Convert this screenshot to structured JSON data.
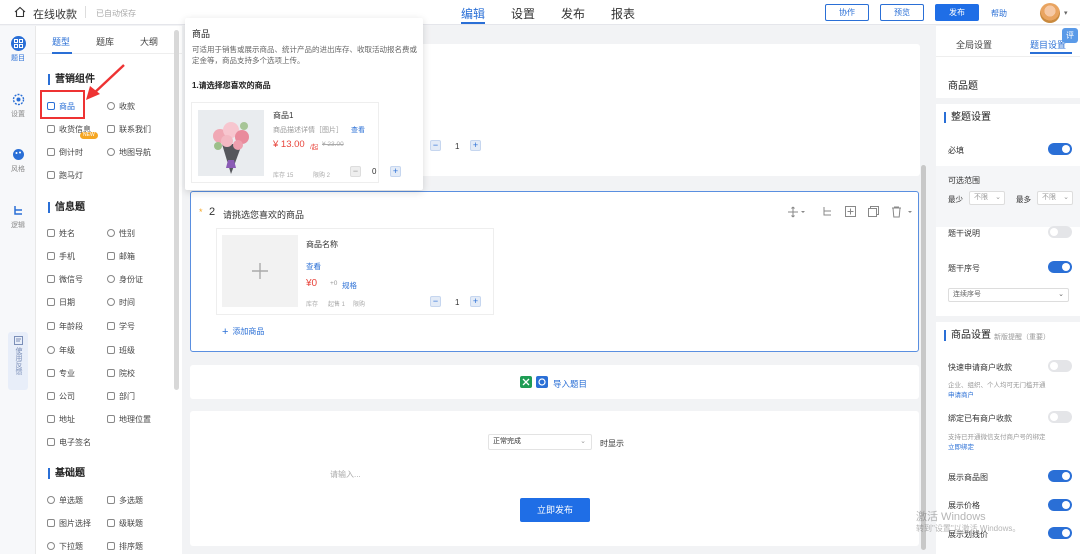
{
  "topbar": {
    "app_title": "在线收款",
    "autosave": "已自动保存",
    "nav": [
      "编辑",
      "设置",
      "发布",
      "报表"
    ],
    "collab": "协作",
    "preview": "预览",
    "publish": "发布",
    "help": "帮助"
  },
  "rail": {
    "items": [
      "题目",
      "设置",
      "风格",
      "逻辑"
    ],
    "feedback": "使用反馈"
  },
  "palette": {
    "tabs": [
      "题型",
      "题库",
      "大纲"
    ],
    "marketing_title": "营销组件",
    "marketing": [
      "商品",
      "收款",
      "收货信息",
      "联系我们",
      "倒计时",
      "地图导航",
      "跑马灯"
    ],
    "new_badge": "NEW",
    "info_title": "信息题",
    "info": [
      "姓名",
      "性别",
      "手机",
      "邮箱",
      "微信号",
      "身份证",
      "日期",
      "时间",
      "年龄段",
      "学号",
      "年级",
      "班级",
      "专业",
      "院校",
      "公司",
      "部门",
      "地址",
      "地理位置",
      "电子签名"
    ],
    "basic_title": "基础题",
    "basic": [
      "单选题",
      "多选题",
      "图片选择",
      "级联题",
      "下拉题",
      "排序题"
    ]
  },
  "popup": {
    "title": "商品",
    "description": "可适用于销售或展示商品、统计产品的进出库存、收取活动报名费或定金等，商品支持多个选项上传。",
    "question": "1.请选择您喜欢的商品",
    "product": {
      "name": "商品1",
      "desc": "商品描述详情［图片］",
      "view": "查看",
      "price": "¥ 13.00",
      "price_unit": "/起",
      "original": "¥ 23.00",
      "stock": "库存 15",
      "limit": "限购 2",
      "qty": "0"
    }
  },
  "q1": {
    "qty": "1"
  },
  "q2": {
    "number": "2",
    "title": "请挑选您喜欢的商品",
    "product_name": "商品名称",
    "view": "查看",
    "price": "¥0",
    "spec_prefix": "+0",
    "spec": "规格",
    "meta": [
      "库存",
      "起售 1",
      "限购"
    ],
    "qty": "1",
    "add": "添加商品"
  },
  "import": {
    "label": "导入题目"
  },
  "footer": {
    "status_select": "正常完成",
    "show_label": "时显示",
    "input_placeholder": "请输入...",
    "publish": "立即发布"
  },
  "right": {
    "tabs": [
      "全局设置",
      "题目设置"
    ],
    "question_type": "商品题",
    "overall_title": "整题设置",
    "required": "必填",
    "range": "可选范围",
    "min": "最少",
    "min_val": "不限",
    "max": "最多",
    "max_val": "不限",
    "desc": "题干说明",
    "seq": "题干序号",
    "seq_select": "连续序号",
    "goods_title": "商品设置",
    "goods_tip": "新版提醒（重要）",
    "quick_apply": "快速申请商户收款",
    "quick_sub": "企业、组织、个人均可无门槛开通",
    "quick_link": "申请商户",
    "bind": "绑定已有商户收款",
    "bind_sub": "支持已开通微信支付商户号的绑定",
    "bind_link": "立即绑定",
    "show_image": "展示商品图",
    "show_price": "展示价格",
    "show_strike": "展示划线价"
  },
  "fab": "评",
  "watermark": [
    "激活 Windows",
    "转到\"设置\"以激活 Windows。"
  ],
  "colors": {
    "accent": "#2a6fd6",
    "price": "#e8453c",
    "highlight_box": "#ee3333"
  }
}
